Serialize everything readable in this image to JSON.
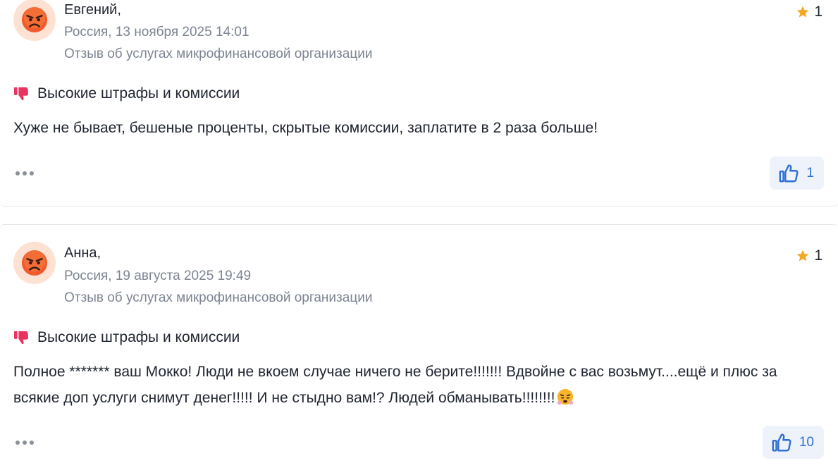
{
  "reviews": [
    {
      "author": "Евгений,",
      "meta": "Россия, 13 ноября 2025 14:01",
      "category": "Отзыв об услугах микрофинансовой организации",
      "rating": "1",
      "tag": "Высокие штрафы и комиссии",
      "text": "Хуже не бывает, бешеные проценты, скрытые комиссии, заплатите в 2 раза больше!",
      "likes": "1"
    },
    {
      "author": "Анна,",
      "meta": "Россия, 19 августа 2025 19:49",
      "category": "Отзыв об услугах микрофинансовой организации",
      "rating": "1",
      "tag": "Высокие штрафы и комиссии",
      "text": "Полное ******* ваш Мокко! Люди не вкоем случае ничего не берите!!!!!!! Вдвойне с вас возьмут....ещё и плюс за всякие доп услуги снимут денег!!!!! И не стыдно вам!? Людей обманывать!!!!!!!!",
      "likes": "10"
    }
  ],
  "icons": {
    "avatar": "angry-face-icon",
    "rating": "star-icon",
    "tag": "thumbs-down-icon",
    "like": "thumbs-up-icon",
    "more": "more-dots-icon",
    "inline_emoji": "huffing-face-icon"
  },
  "colors": {
    "star": "#f5a623",
    "thumbs_down": "#e8345f",
    "like_accent": "#2f6fd6",
    "like_bg": "#eef2fb",
    "avatar_bg": "#fde1d3",
    "meta_text": "#7c8491"
  }
}
